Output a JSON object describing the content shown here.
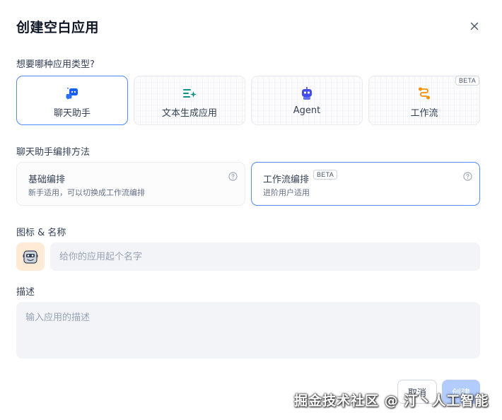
{
  "dialog": {
    "title": "创建空白应用",
    "close_icon": "close-icon"
  },
  "app_type": {
    "label": "想要哪种应用类型?",
    "options": [
      {
        "label": "聊天助手",
        "icon": "chat-bot-icon",
        "icon_color": "#155eef",
        "selected": true
      },
      {
        "label": "文本生成应用",
        "icon": "text-generation-icon",
        "icon_color": "#0e9384",
        "selected": false
      },
      {
        "label": "Agent",
        "icon": "agent-robot-icon",
        "icon_color": "#444ce7",
        "selected": false
      },
      {
        "label": "工作流",
        "icon": "workflow-icon",
        "icon_color": "#f79009",
        "selected": false,
        "badge": "BETA"
      }
    ]
  },
  "orchestration": {
    "label": "聊天助手编排方法",
    "options": [
      {
        "title": "基础编排",
        "desc": "新手适用，可以切换成工作流编排",
        "selected": false
      },
      {
        "title": "工作流编排",
        "badge": "BETA",
        "desc": "进阶用户适用",
        "selected": true
      }
    ]
  },
  "icon_name": {
    "label": "图标 & 名称",
    "emoji": "robot-face-icon",
    "emoji_bg": "#ffead5",
    "name_placeholder": "给你的应用起个名字",
    "name_value": ""
  },
  "description": {
    "label": "描述",
    "placeholder": "输入应用的描述",
    "value": ""
  },
  "footer": {
    "cancel_label": "取消",
    "create_label": "创建"
  },
  "watermark": "掘金技术社区 @ 汀丶人工智能",
  "colors": {
    "accent": "#528bff",
    "primary_disabled": "#b2ccff",
    "input_bg": "#f2f4f7"
  }
}
